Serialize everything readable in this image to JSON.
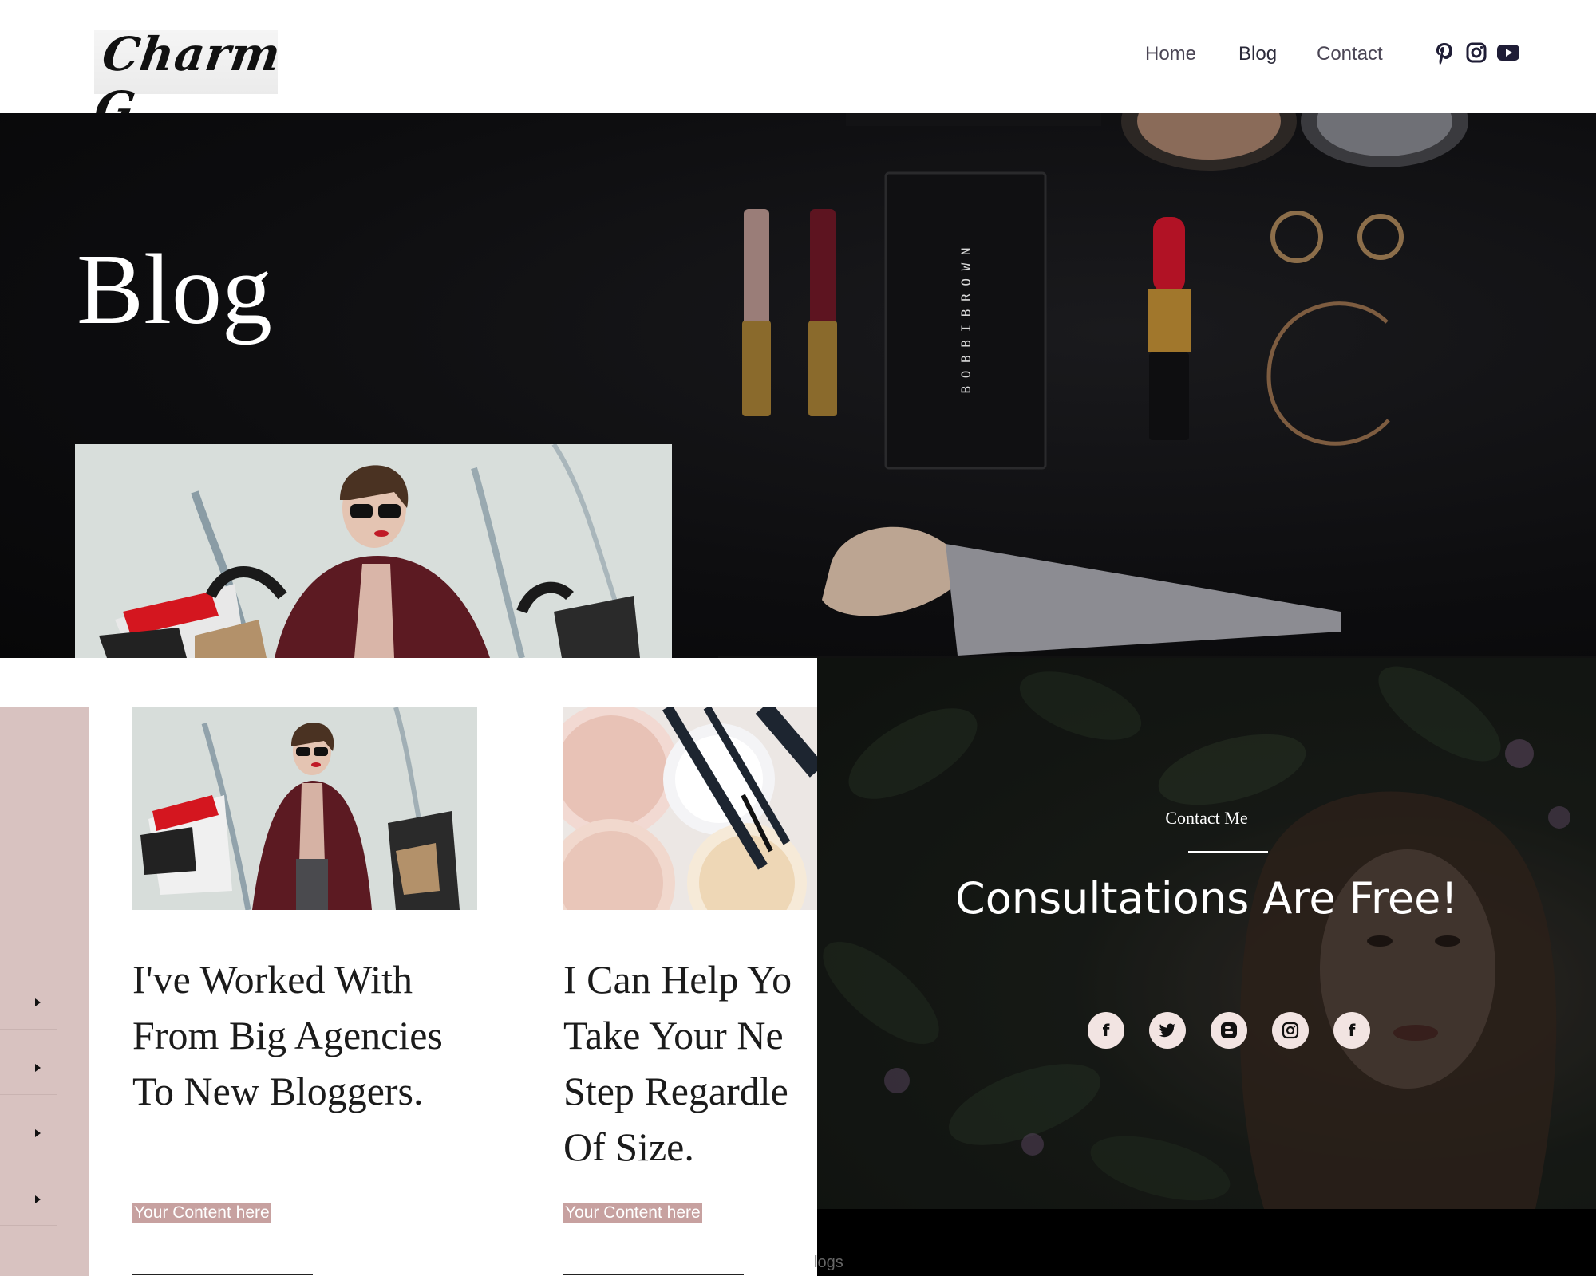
{
  "header": {
    "logo_text": "Charm G.",
    "nav": [
      "Home",
      "Blog",
      "Contact"
    ],
    "social_icons": [
      "pinterest-icon",
      "instagram-icon",
      "youtube-icon"
    ]
  },
  "hero": {
    "title": "Blog"
  },
  "cards": [
    {
      "title": "I've Worked With From Big Agencies To New Bloggers.",
      "link": "Your Content here"
    },
    {
      "title": "I Can Help Yo Take Your Ne Step Regardle Of Size.",
      "link": "Your Content here"
    }
  ],
  "contact": {
    "eyebrow": "Contact Me",
    "heading": "Consultations Are Free!",
    "social_icons": [
      "facebook-icon",
      "twitter-icon",
      "blogger-icon",
      "instagram-icon",
      "facebook-icon"
    ]
  },
  "footer": {
    "partial_text": "logs"
  },
  "colors": {
    "accent_pink": "#d8c2c0",
    "link_pink": "#c7a1a0",
    "nav_text": "#4a4554"
  }
}
